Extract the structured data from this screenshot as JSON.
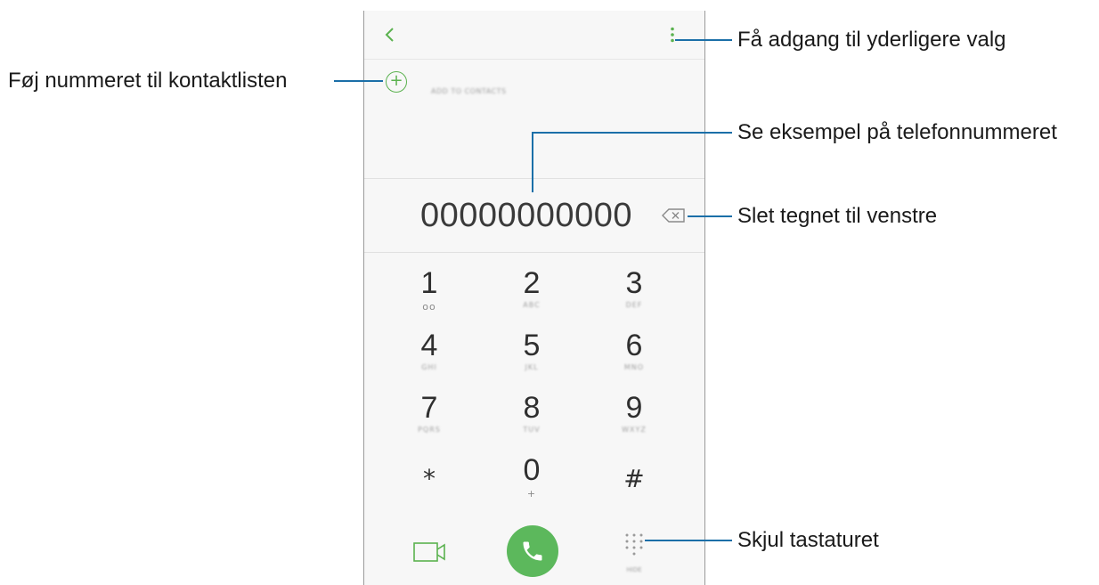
{
  "dialer": {
    "add_to_contacts_label": "ADD TO CONTACTS",
    "phone_number": "00000000000",
    "keys": [
      {
        "digit": "1",
        "sub": "oo"
      },
      {
        "digit": "2",
        "sub": "ABC"
      },
      {
        "digit": "3",
        "sub": "DEF"
      },
      {
        "digit": "4",
        "sub": "GHI"
      },
      {
        "digit": "5",
        "sub": "JKL"
      },
      {
        "digit": "6",
        "sub": "MNO"
      },
      {
        "digit": "7",
        "sub": "PQRS"
      },
      {
        "digit": "8",
        "sub": "TUV"
      },
      {
        "digit": "9",
        "sub": "WXYZ"
      },
      {
        "digit": "*",
        "sub": ""
      },
      {
        "digit": "0",
        "sub": "+"
      },
      {
        "digit": "#",
        "sub": ""
      }
    ],
    "keypad_label": "HIDE"
  },
  "annotations": {
    "more_options": "Få adgang til yderligere valg",
    "add_to_contacts": "Føj nummeret til kontaktlisten",
    "preview_number": "Se eksempel på telefonnummeret",
    "delete_left": "Slet tegnet til venstre",
    "hide_keypad": "Skjul tastaturet"
  },
  "colors": {
    "accent_green": "#5cb85c",
    "callout_line": "#1b6fa8"
  },
  "icons": {
    "back": "chevron-left-icon",
    "more": "more-vertical-icon",
    "add": "plus-circle-icon",
    "backspace": "backspace-icon",
    "video": "video-camera-icon",
    "call": "phone-icon",
    "keypad": "dialpad-icon"
  }
}
